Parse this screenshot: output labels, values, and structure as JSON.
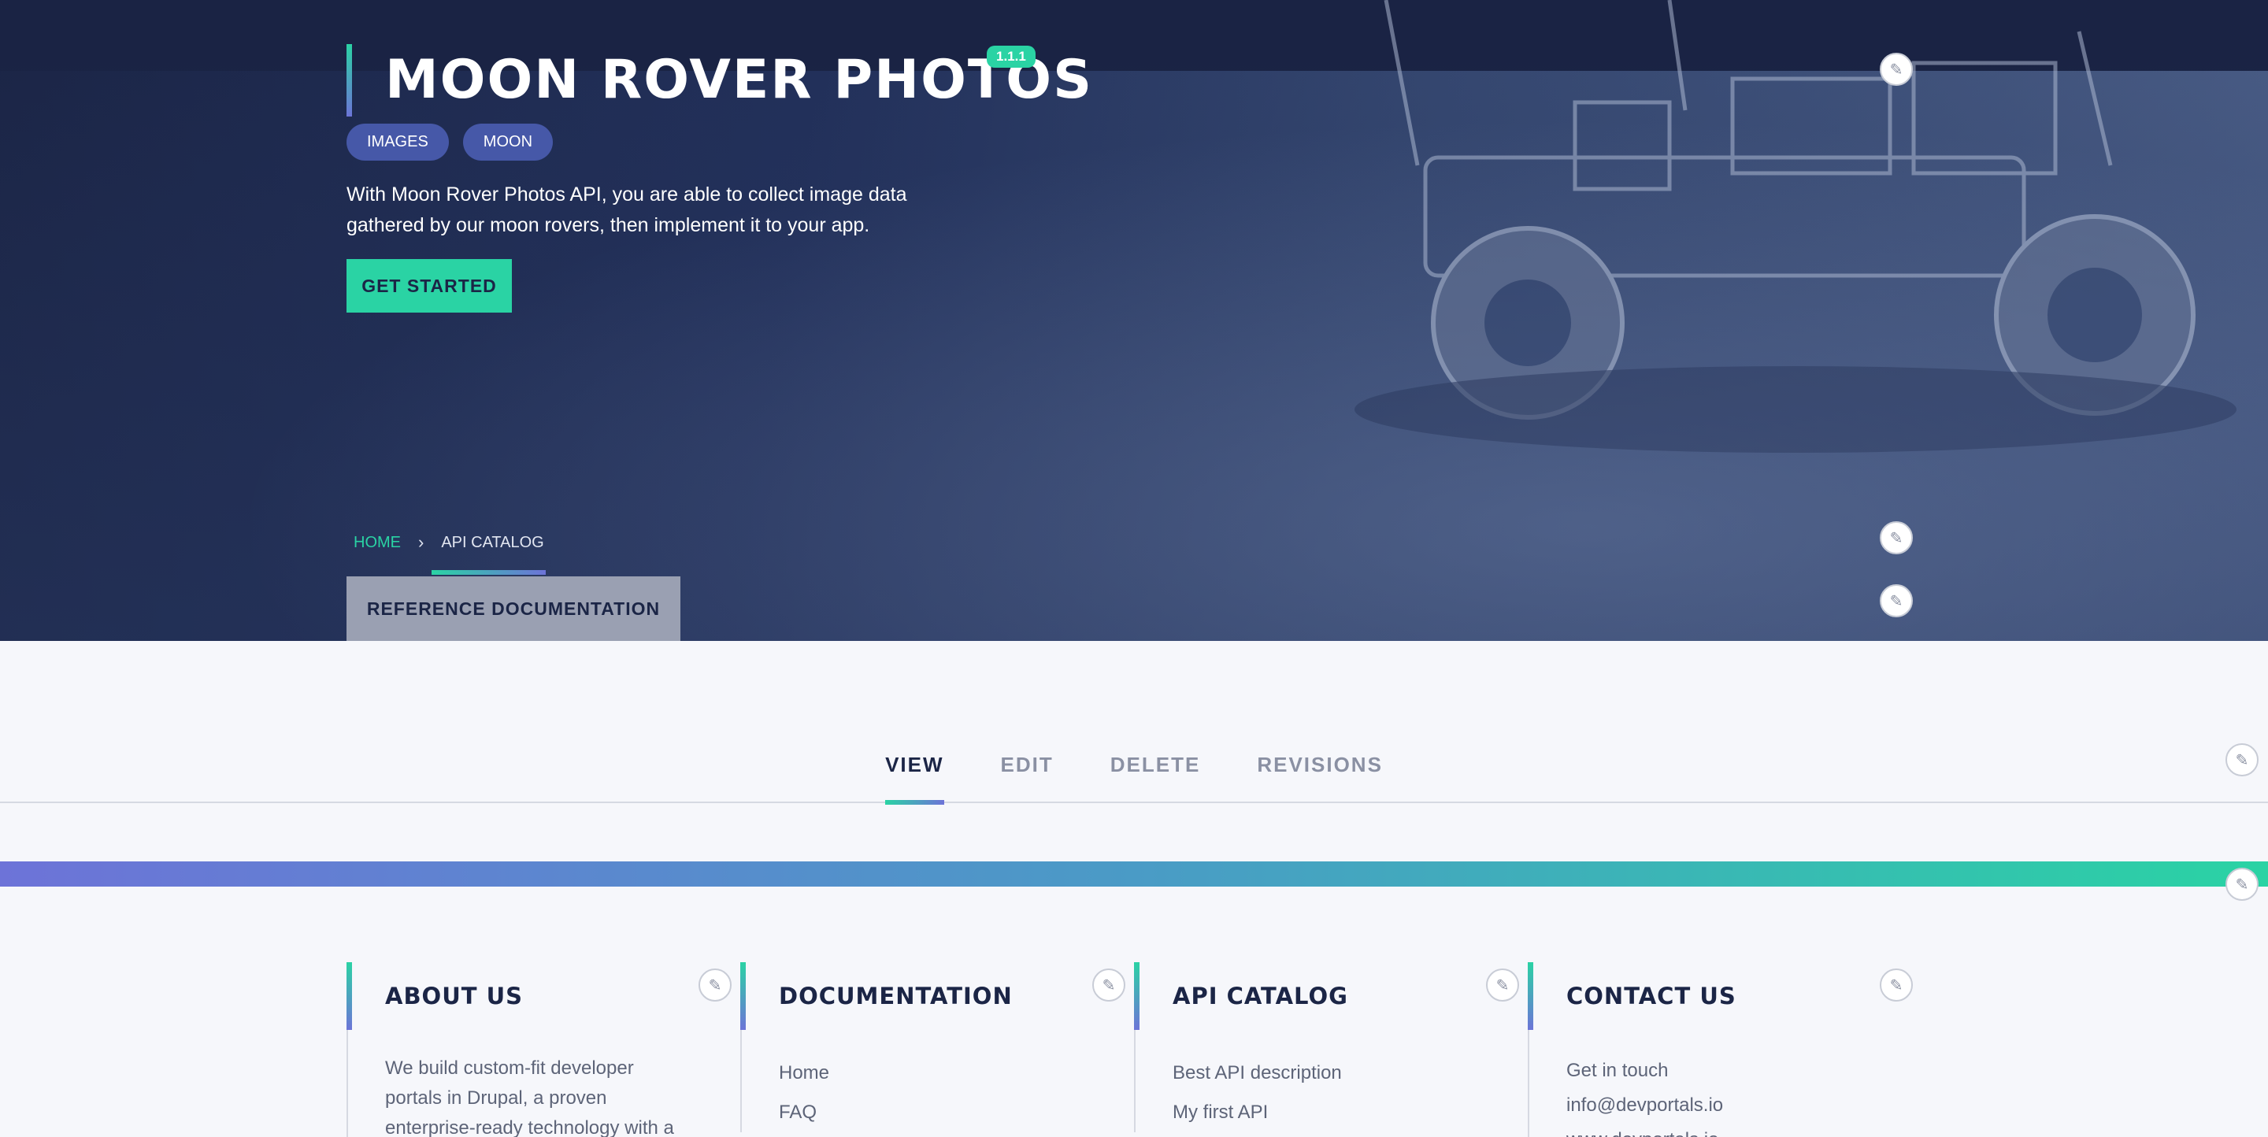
{
  "hero": {
    "title": "MOON ROVER PHOTOS",
    "version": "1.1.1",
    "tags": [
      "IMAGES",
      "MOON"
    ],
    "description": "With Moon Rover Photos API, you are able to collect image data gathered by our moon rovers, then implement it to your app.",
    "cta_label": "GET STARTED"
  },
  "breadcrumb": {
    "home": "HOME",
    "separator": "›",
    "current": "API CATALOG"
  },
  "reference_tab": "REFERENCE DOCUMENTATION",
  "tabs": [
    {
      "label": "VIEW",
      "active": true
    },
    {
      "label": "EDIT",
      "active": false
    },
    {
      "label": "DELETE",
      "active": false
    },
    {
      "label": "REVISIONS",
      "active": false
    }
  ],
  "footer": {
    "about": {
      "heading": "ABOUT US",
      "text": "We build custom-fit developer portals in Drupal, a proven enterprise-ready technology with a"
    },
    "documentation": {
      "heading": "DOCUMENTATION",
      "links": [
        "Home",
        "FAQ"
      ]
    },
    "api_catalog": {
      "heading": "API CATALOG",
      "links": [
        "Best API description",
        "My first API"
      ]
    },
    "contact": {
      "heading": "CONTACT US",
      "lines": [
        "Get in touch",
        "info@devportals.io",
        "www.devportals.io"
      ]
    }
  },
  "icons": {
    "edit": "pencil-icon",
    "chevron": "chevron-right-icon"
  },
  "colors": {
    "navy": "#1b2546",
    "accent_green": "#2ad3a4",
    "accent_purple": "#6d73d8",
    "tag_blue": "#4658a8"
  }
}
